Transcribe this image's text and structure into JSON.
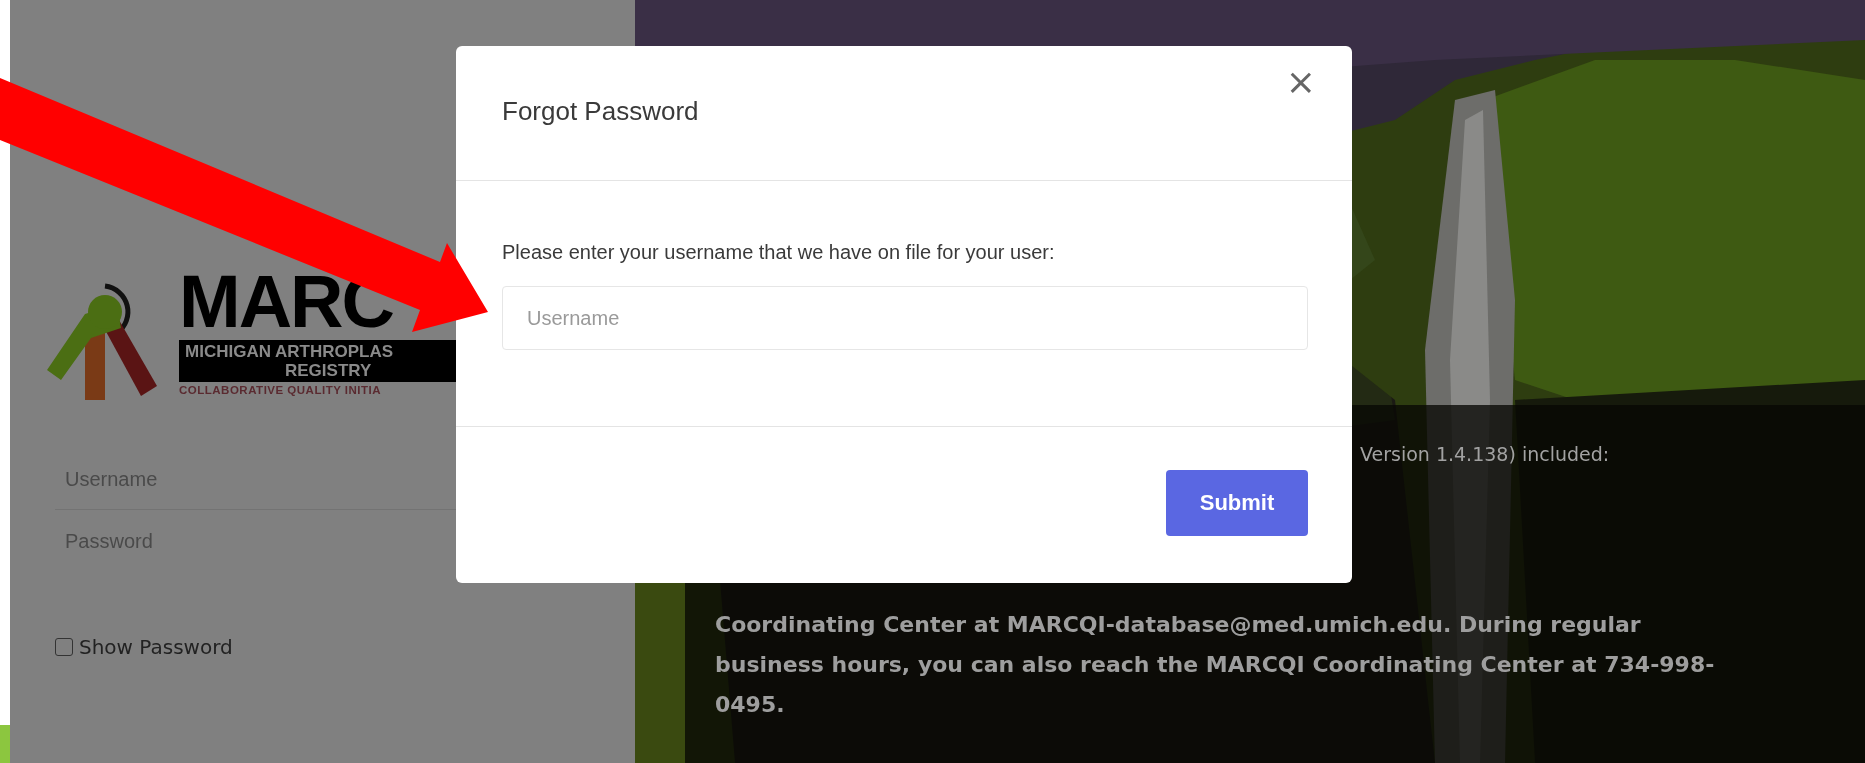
{
  "login_panel": {
    "logo": {
      "title": "MARC",
      "subtitle_1": "MICHIGAN ARTHROPLAS",
      "subtitle_2": "REGISTRY",
      "tagline": "COLLABORATIVE QUALITY INITIA"
    },
    "username": {
      "placeholder": "Username"
    },
    "password": {
      "placeholder": "Password"
    },
    "show_password": {
      "label": "Show Password",
      "checked": false
    }
  },
  "info_panel": {
    "version_line": "Version 1.4.138) included:",
    "contact": "Coordinating Center at MARCQI-database@med.umich.edu. During regular business hours, you can also reach the MARCQI Coordinating Center at 734-998-0495."
  },
  "modal": {
    "title": "Forgot Password",
    "close": "×",
    "prompt": "Please enter your username that we have on file for your user:",
    "username": {
      "placeholder": "Username"
    },
    "submit": "Submit"
  }
}
